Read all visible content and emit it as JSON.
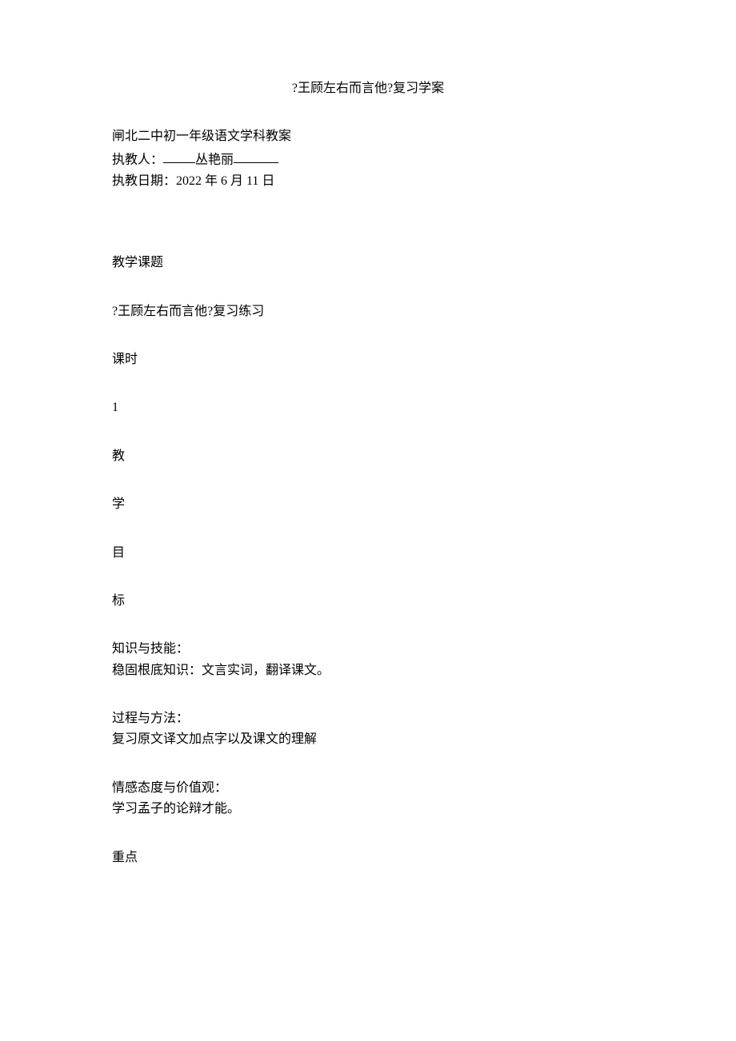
{
  "title": "?王顾左右而言他?复习学案",
  "header": {
    "line1": "闸北二中初一年级语文学科教案",
    "line2_prefix": "执教人：",
    "line2_name": "丛艳丽",
    "line3": "执教日期：2022 年 6 月 11 日"
  },
  "labels": {
    "teaching_topic": "教学课题",
    "topic_value": "?王顾左右而言他?复习练习",
    "class_hours_label": "课时",
    "class_hours_value": "1",
    "objective_chars": [
      "教",
      "学",
      "目",
      "标"
    ],
    "knowledge_skill_heading": "知识与技能：",
    "knowledge_skill_body": "稳固根底知识：文言实词，翻译课文。",
    "process_method_heading": "过程与方法：",
    "process_method_body": "复习原文译文加点字以及课文的理解",
    "emotion_heading": "情感态度与价值观：",
    "emotion_body": "学习孟子的论辩才能。",
    "key_point_label": "重点"
  }
}
